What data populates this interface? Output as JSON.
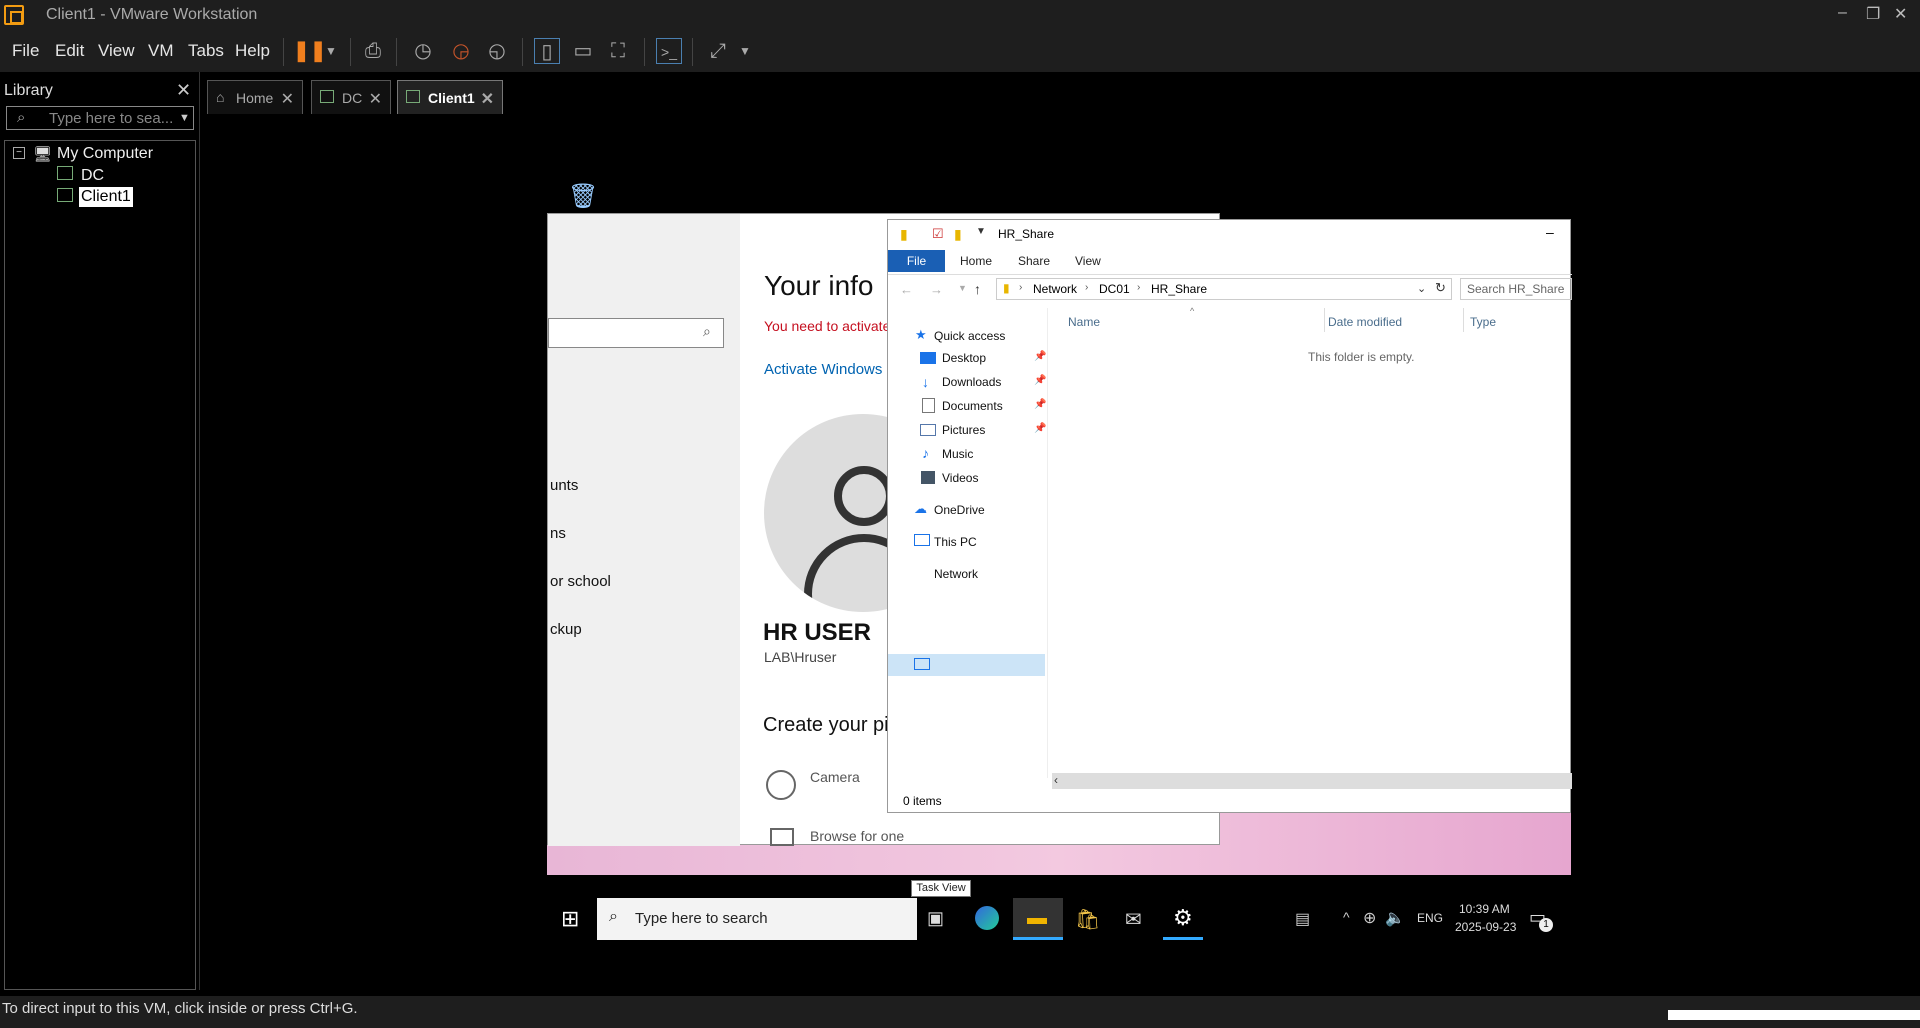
{
  "window": {
    "title": "Client1 - VMware Workstation",
    "min": "–",
    "restore": "❐",
    "close": "✕"
  },
  "menu": [
    "File",
    "Edit",
    "View",
    "VM",
    "Tabs",
    "Help"
  ],
  "library": {
    "title": "Library",
    "search_placeholder": "Type here to sea...",
    "tree": [
      "My Computer",
      "DC",
      "Client1"
    ]
  },
  "tabs": [
    {
      "label": "Home"
    },
    {
      "label": "DC"
    },
    {
      "label": "Client1"
    }
  ],
  "settings": {
    "title": "Your info",
    "activate_warning": "You need to activate",
    "activate_link": "Activate Windows no",
    "nav_items": [
      "unts",
      "ns",
      "or school",
      "ckup"
    ],
    "user_name": "HR USER",
    "user_account": "LAB\\Hruser",
    "create_pic": "Create your pi",
    "camera": "Camera",
    "browse": "Browse for one"
  },
  "explorer": {
    "title": "HR_Share",
    "ribbon": [
      "File",
      "Home",
      "Share",
      "View"
    ],
    "breadcrumb": [
      "Network",
      "DC01",
      "HR_Share"
    ],
    "search_placeholder": "Search HR_Share",
    "columns": [
      "Name",
      "Date modified",
      "Type"
    ],
    "empty": "This folder is empty.",
    "nav": [
      "Quick access",
      "Desktop",
      "Downloads",
      "Documents",
      "Pictures",
      "Music",
      "Videos",
      "OneDrive",
      "This PC",
      "Network"
    ],
    "status": "0 items"
  },
  "taskbar": {
    "search": "Type here to search",
    "tooltip": "Task View",
    "lang": "ENG",
    "time": "10:39 AM",
    "date": "2025-09-23",
    "notif": "1"
  },
  "statusbar": "To direct input to this VM, click inside or press Ctrl+G.",
  "colors": {
    "accent": "#0063b1",
    "vmware_orange": "#f39c12",
    "warning_red": "#c50f1f"
  }
}
